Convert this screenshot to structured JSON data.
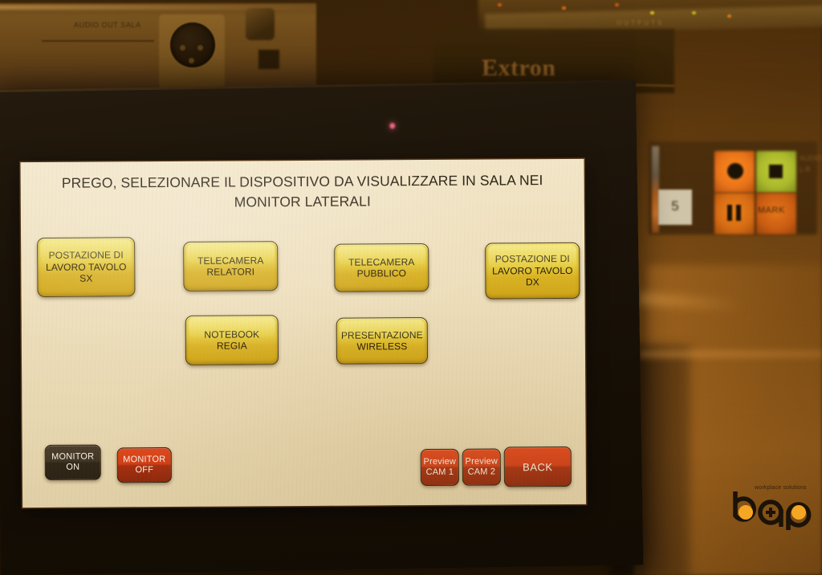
{
  "panel": {
    "power_led": "power-led"
  },
  "screen": {
    "title": "PREGO, SELEZIONARE IL DISPOSITIVO DA VISUALIZZARE IN SALA NEI MONITOR LATERALI",
    "source_buttons": [
      {
        "label": "POSTAZIONE DI\nLAVORO TAVOLO\nSX",
        "name": "source-workstation-left"
      },
      {
        "label": "TELECAMERA\nRELATORI",
        "name": "source-camera-speakers"
      },
      {
        "label": "TELECAMERA\nPUBBLICO",
        "name": "source-camera-audience"
      },
      {
        "label": "POSTAZIONE DI\nLAVORO TAVOLO\nDX",
        "name": "source-workstation-right"
      },
      {
        "label": "NOTEBOOK\nREGIA",
        "name": "source-notebook-control"
      },
      {
        "label": "PRESENTAZIONE\nWIRELESS",
        "name": "source-wireless-presentation"
      }
    ],
    "control_buttons": [
      {
        "label": "MONITOR\nON",
        "name": "monitor-on-button",
        "style": "dark"
      },
      {
        "label": "MONITOR\nOFF",
        "name": "monitor-off-button",
        "style": "red"
      },
      {
        "label": "Preview\nCAM 1",
        "name": "preview-cam-1-button",
        "style": "red"
      },
      {
        "label": "Preview\nCAM 2",
        "name": "preview-cam-2-button",
        "style": "red"
      },
      {
        "label": "BACK",
        "name": "back-button",
        "style": "red"
      }
    ]
  },
  "background": {
    "audio_label": "AUDIO OUT\nSALA",
    "extron_brand": "Extron",
    "rack_outputs_label": "OUTPUTS",
    "recorder": {
      "channel_number": "5",
      "mark_label": "MARK",
      "side_label": "AUDIO\nL    R"
    }
  },
  "logo": {
    "tagline": "workplace solutions",
    "wordmark": "bgp",
    "dot_color": "#f5a623",
    "ink_color": "#1b1208"
  },
  "colors": {
    "screen_background": "#eedfbc",
    "source_button_top": "#efdc5e",
    "source_button_bottom": "#cfa418",
    "red_button": "#d23d16",
    "dark_button": "#413526",
    "title_text": "#2c2417",
    "bezel": "#1b1309"
  }
}
